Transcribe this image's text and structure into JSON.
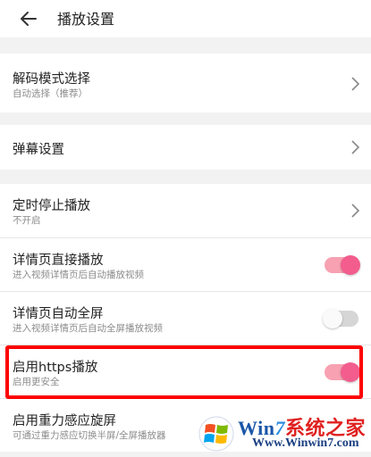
{
  "header": {
    "title": "播放设置",
    "back_icon": "arrow-left-icon"
  },
  "settings": {
    "decode": {
      "label": "解码模式选择",
      "sub": "自动选择（推荐）"
    },
    "danmaku": {
      "label": "弹幕设置"
    },
    "timer": {
      "label": "定时停止播放",
      "sub": "不开启"
    },
    "autoplay": {
      "label": "详情页直接播放",
      "sub": "进入视频详情页后自动播放视频",
      "enabled": true
    },
    "fullscreen": {
      "label": "详情页自动全屏",
      "sub": "进入视频详情页后自动全屏播放视频",
      "enabled": false
    },
    "https": {
      "label": "启用https播放",
      "sub": "启用更安全",
      "enabled": true
    },
    "gravity": {
      "label": "启用重力感应旋屏",
      "sub": "可通过重力感应切换半屏/全屏播放器"
    }
  },
  "colors": {
    "accent": "#f25d8e",
    "accent_track": "#f7a1b2",
    "highlight": "#ff0000"
  },
  "watermark": {
    "brand_a": "Win",
    "brand_seven": "7",
    "brand_cn": "系统之家",
    "url": "Www.Winwin7.com"
  }
}
